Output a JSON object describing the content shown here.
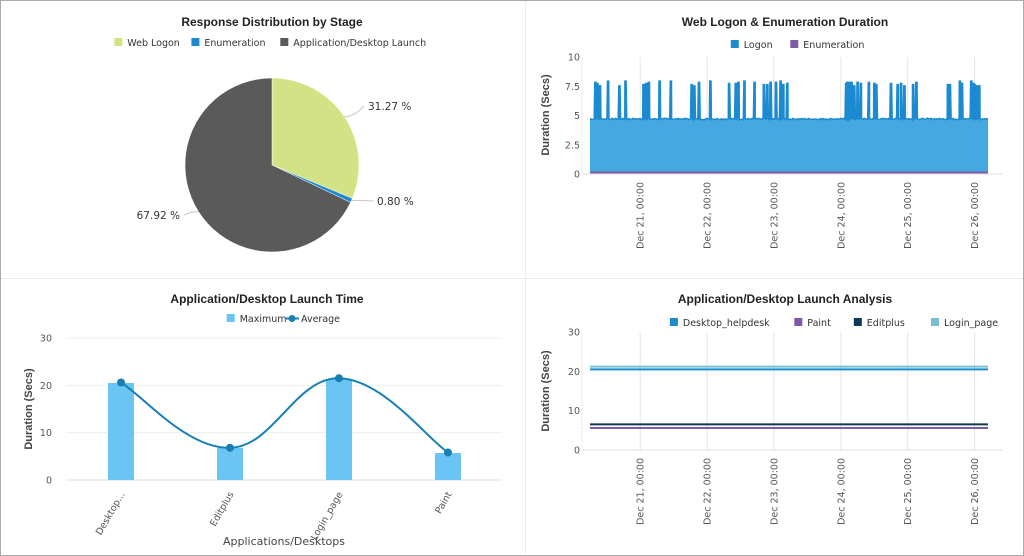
{
  "chart_data": [
    {
      "id": "pie",
      "type": "pie",
      "title": "Response Distribution by Stage",
      "legend": [
        "Web Logon",
        "Enumeration",
        "Application/Desktop Launch"
      ],
      "legend_placement": "top",
      "slices": [
        {
          "label": "Web Logon",
          "value": 31.27,
          "display": "31.27 %",
          "color": "#d3e284"
        },
        {
          "label": "Enumeration",
          "value": 0.8,
          "display": "0.80 %",
          "color": "#1b8ad0"
        },
        {
          "label": "Application/Desktop Launch",
          "value": 67.92,
          "display": "67.92 %",
          "color": "#5a5a5a"
        }
      ]
    },
    {
      "id": "logon",
      "type": "area",
      "title": "Web Logon & Enumeration Duration",
      "ylabel": "Duration (Secs)",
      "xlabel": "",
      "ylim": [
        0,
        10
      ],
      "yticks": [
        0,
        2.5,
        5,
        7.5,
        10
      ],
      "ytick_labels": [
        "0",
        "2.5",
        "5",
        "7.5",
        "10"
      ],
      "xticks": [
        "Dec 21, 00:00",
        "Dec 22, 00:00",
        "Dec 23, 00:00",
        "Dec 24, 00:00",
        "Dec 25, 00:00",
        "Dec 26, 00:00"
      ],
      "xrange_days": [
        20.25,
        26.2
      ],
      "grid": true,
      "legend_placement": "top",
      "series": [
        {
          "name": "Logon",
          "color": "#1b8ad0",
          "fill": "#45a9e1",
          "baseline": 4.7,
          "spikes_at_days": [
            20.33,
            20.36,
            20.4,
            20.52,
            20.69,
            20.78,
            21.05,
            21.09,
            21.13,
            21.29,
            21.46,
            21.77,
            21.81,
            21.88,
            22.05,
            22.33,
            22.43,
            22.47,
            22.56,
            22.71,
            22.85,
            22.9,
            22.95,
            23.03,
            23.1,
            23.14,
            23.2,
            24.08,
            24.1,
            24.13,
            24.16,
            24.2,
            24.25,
            24.3,
            24.42,
            24.5,
            24.53,
            24.75,
            24.85,
            24.9,
            24.95,
            25.08,
            25.13,
            25.6,
            25.63,
            25.78,
            25.81,
            25.95,
            25.98,
            26.0,
            26.03,
            26.07
          ],
          "spike_values": [
            7.9,
            7.8,
            7.6,
            8.0,
            7.6,
            8.0,
            7.7,
            7.8,
            7.9,
            8.0,
            8.0,
            7.7,
            7.6,
            7.9,
            8.0,
            7.8,
            7.8,
            7.9,
            8.0,
            7.9,
            7.7,
            7.7,
            7.9,
            7.9,
            8.0,
            7.7,
            7.8,
            7.8,
            7.9,
            7.9,
            7.9,
            7.6,
            7.9,
            7.8,
            7.9,
            7.8,
            7.7,
            7.8,
            7.7,
            7.8,
            7.6,
            7.7,
            7.9,
            7.7,
            7.7,
            8.0,
            7.8,
            8.0,
            7.8,
            7.7,
            7.6,
            7.6
          ]
        },
        {
          "name": "Enumeration",
          "color": "#7e5ca3",
          "values_const": 0.1
        }
      ]
    },
    {
      "id": "launch",
      "type": "bar",
      "title": "Application/Desktop Launch Time",
      "xlabel": "Applications/Desktops",
      "ylabel": "Duration (Secs)",
      "ylim": [
        0,
        30
      ],
      "yticks": [
        0,
        10,
        20,
        30
      ],
      "categories": [
        "Desktop...",
        "Editplus",
        "Login_page",
        "Paint"
      ],
      "grid": true,
      "legend_placement": "top",
      "series": [
        {
          "name": "Maximum",
          "type": "bar",
          "color": "#6ac5f4",
          "values": [
            20.5,
            6.8,
            21.3,
            5.7
          ]
        },
        {
          "name": "Average",
          "type": "line",
          "color": "#167fb6",
          "values": [
            20.6,
            6.8,
            21.5,
            5.8
          ]
        }
      ]
    },
    {
      "id": "analysis",
      "type": "line",
      "title": "Application/Desktop Launch Analysis",
      "ylabel": "Duration (Secs)",
      "xlabel": "",
      "ylim": [
        0,
        30
      ],
      "yticks": [
        0,
        10,
        20,
        30
      ],
      "xticks": [
        "Dec 21, 00:00",
        "Dec 22, 00:00",
        "Dec 23, 00:00",
        "Dec 24, 00:00",
        "Dec 25, 00:00",
        "Dec 26, 00:00"
      ],
      "xrange_days": [
        20.25,
        26.2
      ],
      "grid": true,
      "legend_placement": "top-right",
      "series": [
        {
          "name": "Desktop_helpdesk",
          "color": "#1b8ad0",
          "value": 20.5
        },
        {
          "name": "Paint",
          "color": "#7e5ca3",
          "value": 5.6
        },
        {
          "name": "Editplus",
          "color": "#0d3b55",
          "value": 6.5
        },
        {
          "name": "Login_page",
          "color": "#78bfd3",
          "value": 21.2
        }
      ]
    }
  ]
}
